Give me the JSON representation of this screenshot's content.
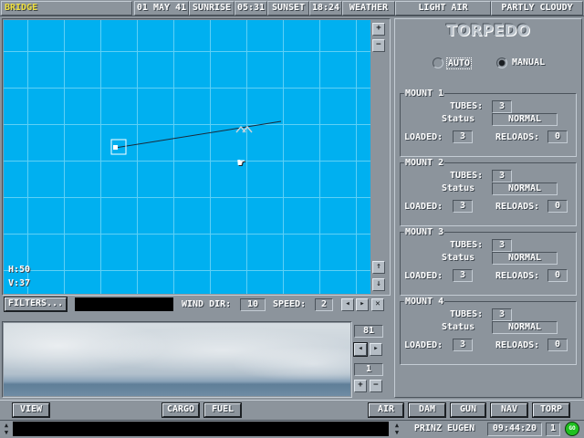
{
  "topbar": {
    "location": "BRIDGE",
    "date": "01 MAY 41",
    "sunrise_label": "SUNRISE",
    "sunrise_time": "05:31",
    "sunset_label": "SUNSET",
    "sunset_time": "18:24",
    "weather_label": "WEATHER",
    "air_condition": "LIGHT AIR",
    "sky_condition": "PARTLY CLOUDY"
  },
  "map": {
    "h_readout": "H:50",
    "v_readout": "V:37",
    "zoom_in": "+",
    "zoom_out": "−",
    "scroll_up": "⇑",
    "scroll_down": "⇓"
  },
  "windbar": {
    "filters_label": "FILTERS...",
    "wind_dir_label": "WIND DIR:",
    "wind_dir_value": "10",
    "speed_label": "SPEED:",
    "speed_value": "2",
    "left_arrow": "◂",
    "right_arrow": "▸",
    "close": "✕"
  },
  "camera": {
    "bearing_value": "81",
    "zoom_value": "1",
    "bearing_left": "◂",
    "bearing_right": "▸",
    "zoom_plus": "+",
    "zoom_minus": "−"
  },
  "torpedo": {
    "title": "TORPEDO",
    "auto_label": "AUTO",
    "manual_label": "MANUAL",
    "mode": "manual",
    "tubes_label": "TUBES:",
    "status_label": "Status",
    "loaded_label": "LOADED:",
    "reloads_label": "RELOADS:",
    "mounts": [
      {
        "name": "MOUNT 1",
        "tubes": "3",
        "status": "NORMAL",
        "loaded": "3",
        "reloads": "0"
      },
      {
        "name": "MOUNT 2",
        "tubes": "3",
        "status": "NORMAL",
        "loaded": "3",
        "reloads": "0"
      },
      {
        "name": "MOUNT 3",
        "tubes": "3",
        "status": "NORMAL",
        "loaded": "3",
        "reloads": "0"
      },
      {
        "name": "MOUNT 4",
        "tubes": "3",
        "status": "NORMAL",
        "loaded": "3",
        "reloads": "0"
      }
    ]
  },
  "bottombar": {
    "view": "VIEW",
    "cargo": "CARGO",
    "fuel": "FUEL",
    "air": "AIR",
    "dam": "DAM",
    "gun": "GUN",
    "nav": "NAV",
    "torp": "TORP"
  },
  "statusbar": {
    "ship_name": "PRINZ EUGEN",
    "game_time": "09:44:20",
    "time_compression": "1",
    "go_label": "GO"
  },
  "colors": {
    "sea": "#00b0f0",
    "panel": "#8c949c",
    "location_text": "#f0e040",
    "go_button": "#20c020"
  }
}
